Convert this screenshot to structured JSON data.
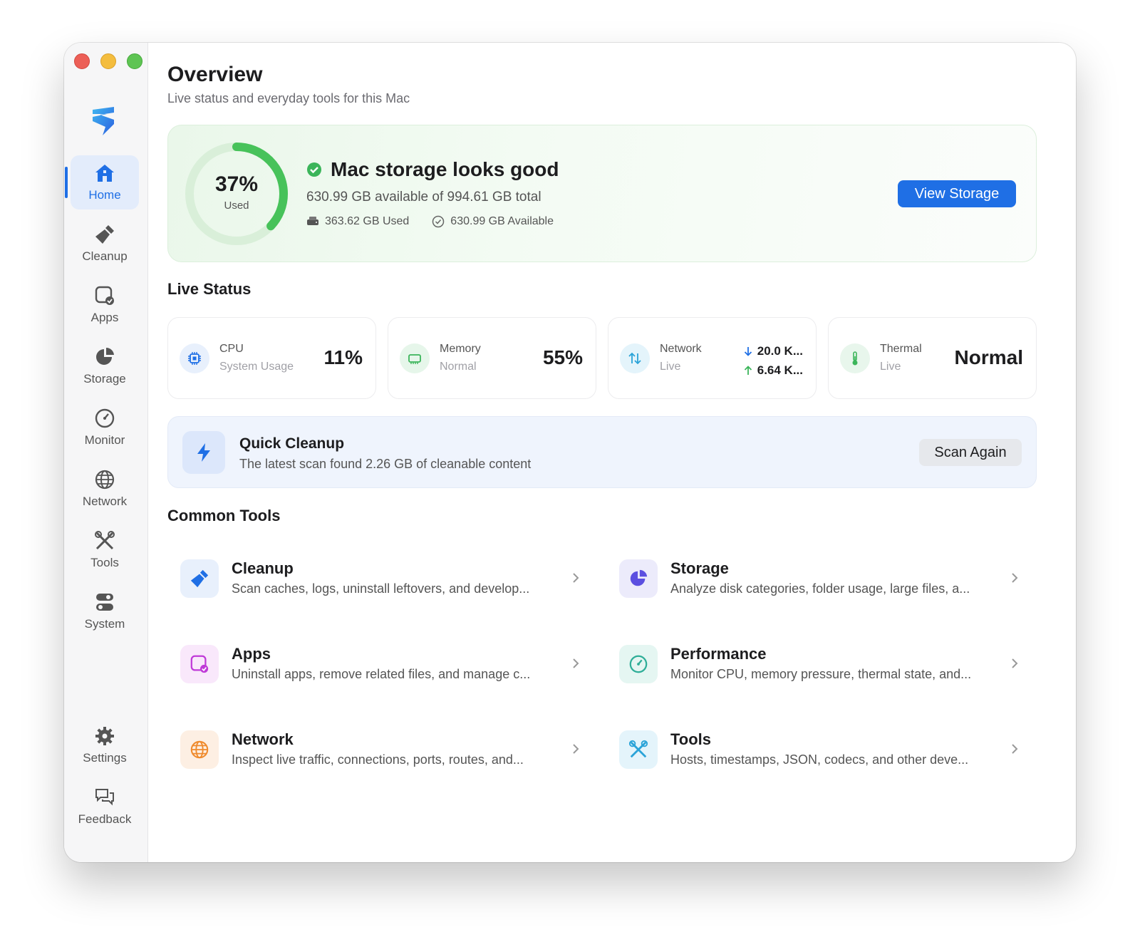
{
  "sidebar": {
    "nav": [
      {
        "label": "Home",
        "icon": "home-icon"
      },
      {
        "label": "Cleanup",
        "icon": "broom-icon"
      },
      {
        "label": "Apps",
        "icon": "apps-icon"
      },
      {
        "label": "Storage",
        "icon": "pie-chart-icon"
      },
      {
        "label": "Monitor",
        "icon": "gauge-icon"
      },
      {
        "label": "Network",
        "icon": "globe-icon"
      },
      {
        "label": "Tools",
        "icon": "tools-icon"
      },
      {
        "label": "System",
        "icon": "toggles-icon"
      }
    ],
    "bottom": [
      {
        "label": "Settings",
        "icon": "gear-icon"
      },
      {
        "label": "Feedback",
        "icon": "chat-bubbles-icon"
      }
    ]
  },
  "header": {
    "title": "Overview",
    "subtitle": "Live status and everyday tools for this Mac"
  },
  "storage": {
    "percent_label": "37%",
    "used_fraction": 0.37,
    "ring_label": "Used",
    "title": "Mac storage looks good",
    "summary": "630.99 GB available of 994.61 GB total",
    "used": "363.62 GB Used",
    "available": "630.99 GB Available",
    "button": "View Storage"
  },
  "live_status": {
    "title": "Live Status",
    "cpu": {
      "name": "CPU",
      "sub": "System Usage",
      "value": "11%"
    },
    "memory": {
      "name": "Memory",
      "sub": "Normal",
      "value": "55%"
    },
    "network": {
      "name": "Network",
      "sub": "Live",
      "down": "20.0 K...",
      "up": "6.64 K..."
    },
    "thermal": {
      "name": "Thermal",
      "sub": "Live",
      "value": "Normal"
    }
  },
  "quick_cleanup": {
    "title": "Quick Cleanup",
    "subtitle": "The latest scan found 2.26 GB of cleanable content",
    "button": "Scan Again"
  },
  "common_tools": {
    "title": "Common Tools",
    "items": [
      {
        "title": "Cleanup",
        "desc": "Scan caches, logs, uninstall leftovers, and develop..."
      },
      {
        "title": "Storage",
        "desc": "Analyze disk categories, folder usage, large files, a..."
      },
      {
        "title": "Apps",
        "desc": "Uninstall apps, remove related files, and manage c..."
      },
      {
        "title": "Performance",
        "desc": "Monitor CPU, memory pressure, thermal state, and..."
      },
      {
        "title": "Network",
        "desc": "Inspect live traffic, connections, ports, routes, and..."
      },
      {
        "title": "Tools",
        "desc": "Hosts, timestamps, JSON, codecs, and other deve..."
      }
    ]
  },
  "colors": {
    "accent": "#1f6fe5",
    "ring_green": "#47c25a",
    "ring_track": "#d9efd9"
  }
}
